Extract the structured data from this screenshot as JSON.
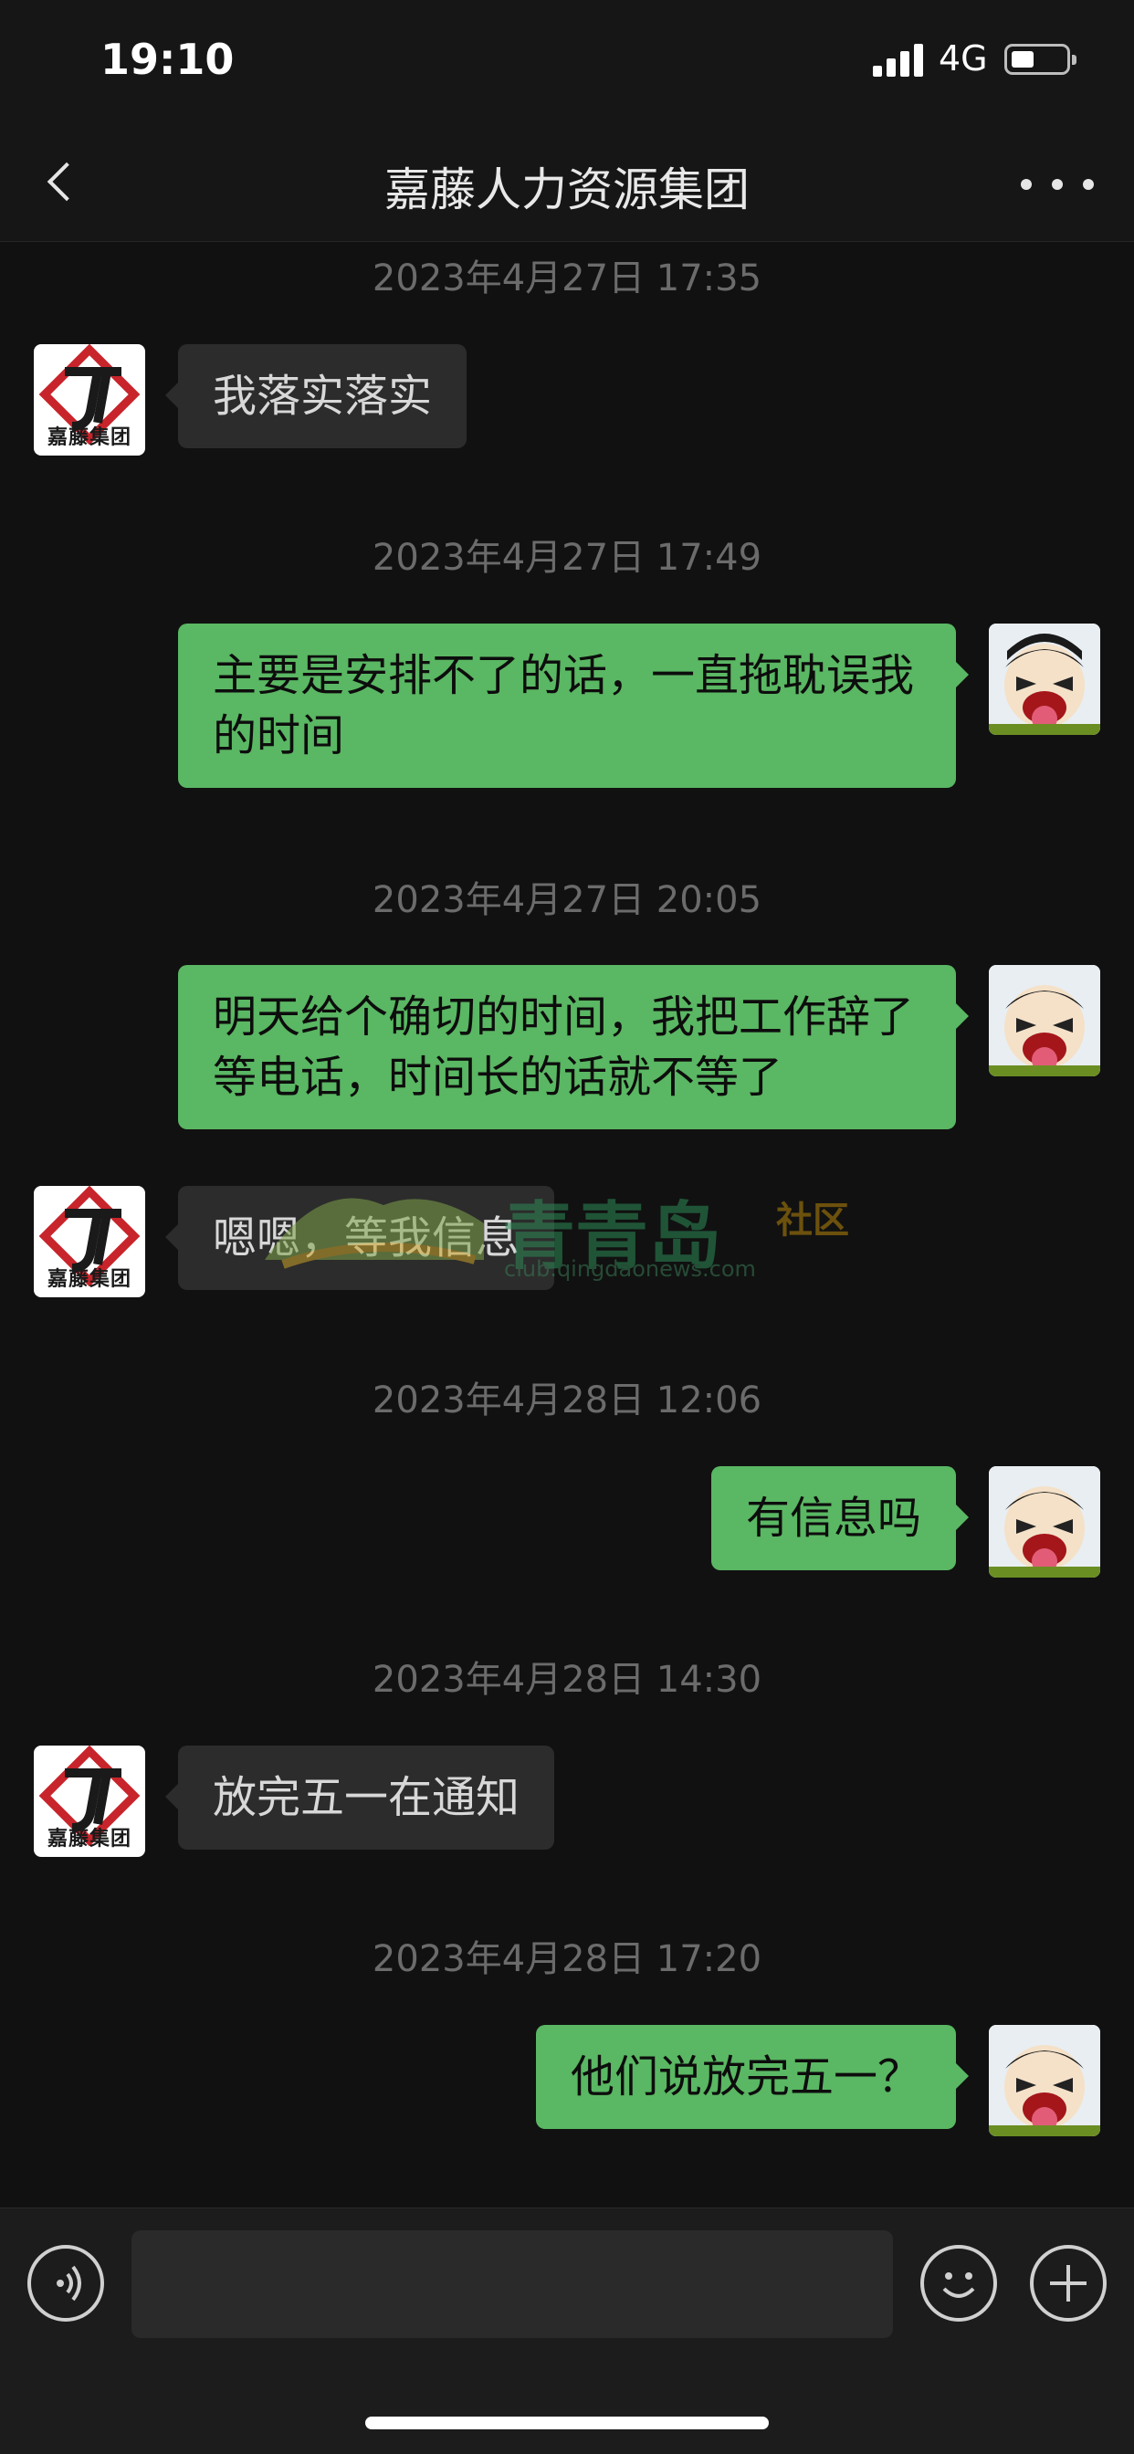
{
  "status_bar": {
    "time": "19:10",
    "network": "4G"
  },
  "nav": {
    "title": "嘉藤人力资源集团"
  },
  "contact": {
    "logo_text": "嘉藤集团"
  },
  "watermark": {
    "brand": "青青岛",
    "tag": "社区",
    "url": "club.qingdaonews.com"
  },
  "messages": [
    {
      "type": "time",
      "text": "2023年4月27日 17:35"
    },
    {
      "type": "in",
      "text": "我落实落实"
    },
    {
      "type": "time",
      "text": "2023年4月27日 17:49"
    },
    {
      "type": "out",
      "text": "主要是安排不了的话，一直拖耽误我的时间"
    },
    {
      "type": "time",
      "text": "2023年4月27日 20:05"
    },
    {
      "type": "out",
      "text": "明天给个确切的时间，我把工作辞了等电话，时间长的话就不等了"
    },
    {
      "type": "in",
      "text": "嗯嗯，等我信息"
    },
    {
      "type": "time",
      "text": "2023年4月28日 12:06"
    },
    {
      "type": "out",
      "text": "有信息吗"
    },
    {
      "type": "time",
      "text": "2023年4月28日 14:30"
    },
    {
      "type": "in",
      "text": "放完五一在通知"
    },
    {
      "type": "time",
      "text": "2023年4月28日 17:20"
    },
    {
      "type": "out",
      "text": "他们说放完五一？"
    }
  ],
  "input": {
    "placeholder": ""
  },
  "colors": {
    "bubble_out": "#5ab763",
    "bubble_in": "#2c2c2c",
    "background": "#111111"
  }
}
